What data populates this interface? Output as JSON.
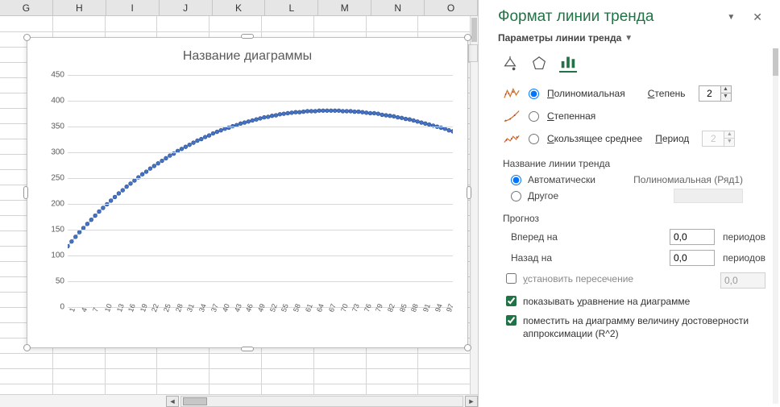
{
  "columns": [
    "G",
    "H",
    "I",
    "J",
    "K",
    "L",
    "M",
    "N",
    "O"
  ],
  "chart": {
    "title": "Название диаграммы",
    "y_ticks": [
      0,
      50,
      100,
      150,
      200,
      250,
      300,
      350,
      400,
      450
    ],
    "x_ticks": [
      1,
      4,
      7,
      10,
      13,
      16,
      19,
      22,
      25,
      28,
      31,
      34,
      37,
      40,
      43,
      46,
      49,
      52,
      55,
      58,
      61,
      64,
      67,
      70,
      73,
      76,
      79,
      82,
      85,
      88,
      91,
      94,
      97
    ]
  },
  "chart_data": {
    "type": "scatter",
    "x": [
      1,
      2,
      3,
      4,
      5,
      6,
      7,
      8,
      9,
      10,
      11,
      12,
      13,
      14,
      15,
      16,
      17,
      18,
      19,
      20,
      21,
      22,
      23,
      24,
      25,
      26,
      27,
      28,
      29,
      30,
      31,
      32,
      33,
      34,
      35,
      36,
      37,
      38,
      39,
      40,
      41,
      42,
      43,
      44,
      45,
      46,
      47,
      48,
      49,
      50,
      51,
      52,
      53,
      54,
      55,
      56,
      57,
      58,
      59,
      60,
      61,
      62,
      63,
      64,
      65,
      66,
      67,
      68,
      69,
      70,
      71,
      72,
      73,
      74,
      75,
      76,
      77,
      78,
      79,
      80,
      81,
      82,
      83,
      84,
      85,
      86,
      87,
      88,
      89,
      90,
      91,
      92,
      93,
      94,
      95,
      96,
      97,
      98,
      99
    ],
    "y": [
      119,
      128,
      137,
      146,
      154,
      162,
      170,
      178,
      186,
      193,
      200,
      207,
      214,
      221,
      227,
      234,
      240,
      246,
      252,
      258,
      263,
      269,
      274,
      279,
      284,
      289,
      294,
      298,
      303,
      307,
      311,
      315,
      319,
      323,
      326,
      330,
      333,
      337,
      340,
      343,
      346,
      348,
      351,
      353,
      356,
      358,
      360,
      362,
      364,
      366,
      368,
      369,
      371,
      372,
      374,
      375,
      376,
      377,
      378,
      378,
      379,
      380,
      380,
      380,
      381,
      381,
      381,
      381,
      381,
      381,
      380,
      380,
      380,
      379,
      379,
      378,
      377,
      376,
      376,
      375,
      373,
      372,
      371,
      370,
      368,
      367,
      365,
      364,
      362,
      360,
      358,
      356,
      354,
      352,
      350,
      348,
      346,
      343,
      341
    ],
    "title": "Название диаграммы",
    "xlabel": "",
    "ylabel": "",
    "xlim": [
      1,
      99
    ],
    "ylim": [
      0,
      450
    ],
    "trendline": {
      "type": "polynomial",
      "degree": 2
    }
  },
  "pane": {
    "title": "Формат линии тренда",
    "subtitle": "Параметры линии тренда",
    "opts": {
      "polynomial": "Полиномиальная",
      "degree_label": "Степень",
      "degree_value": "2",
      "power": "Степенная",
      "moving_avg": "Скользящее среднее",
      "period_label": "Период",
      "period_value": "2"
    },
    "name_section": {
      "title": "Название линии тренда",
      "auto": "Автоматически",
      "auto_value": "Полиномиальная (Ряд1)",
      "other": "Другое"
    },
    "forecast": {
      "title": "Прогноз",
      "forward": "Вперед на",
      "backward": "Назад на",
      "forward_val": "0,0",
      "backward_val": "0,0",
      "unit": "периодов"
    },
    "checks": {
      "intercept": "установить пересечение",
      "intercept_val": "0,0",
      "show_eq": "показывать уравнение на диаграмме",
      "show_r2": "поместить на диаграмму величину достоверности аппроксимации (R^2)"
    }
  }
}
